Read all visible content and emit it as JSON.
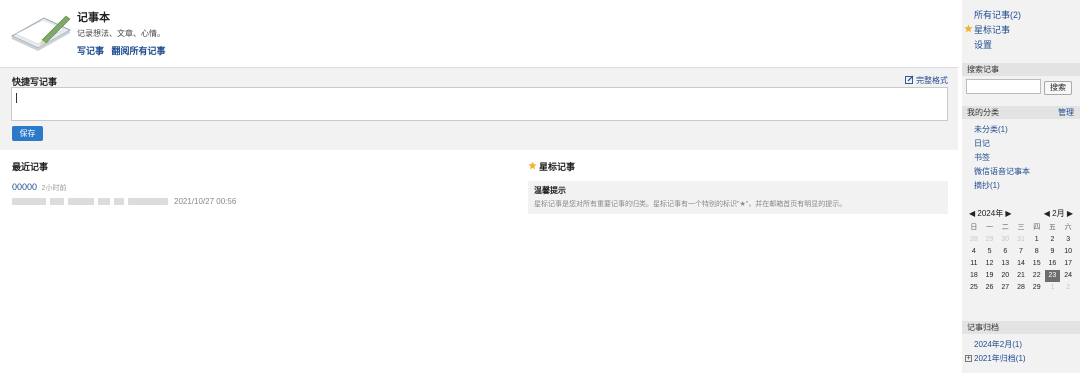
{
  "header": {
    "title": "记事本",
    "subtitle": "记录想法、文章、心情。",
    "links": [
      "写记事",
      "翻阅所有记事"
    ]
  },
  "quick_note": {
    "title": "快捷写记事",
    "full_format": "完整格式",
    "input_value": "",
    "save_label": "保存"
  },
  "recent": {
    "title": "最近记事",
    "items": [
      {
        "title": "00000",
        "ago": "2小时前",
        "date": "2021/10/27 00:56"
      }
    ]
  },
  "starred": {
    "title": "星标记事",
    "tip_title": "温馨提示",
    "tip_text": "星标记事是您对所有重要记事的归类。星标记事有一个特别的标识\"★\"，并在邮箱首页有明显的提示。"
  },
  "sidebar": {
    "nav": [
      "所有记事(2)",
      "星标记事",
      "设置"
    ],
    "search_heading": "搜索记事",
    "search_value": "",
    "search_button": "搜索",
    "categories_heading": "我的分类",
    "manage_label": "管理",
    "categories": [
      "未分类(1)",
      "日记",
      "书签",
      "微信语音记事本",
      "摘抄(1)"
    ],
    "calendar": {
      "year_label": "2024年",
      "month_label": "2月",
      "weekdays": [
        "日",
        "一",
        "二",
        "三",
        "四",
        "五",
        "六"
      ],
      "rows": [
        [
          "28",
          "29",
          "30",
          "31",
          "1",
          "2",
          "3"
        ],
        [
          "4",
          "5",
          "6",
          "7",
          "8",
          "9",
          "10"
        ],
        [
          "11",
          "12",
          "13",
          "14",
          "15",
          "16",
          "17"
        ],
        [
          "18",
          "19",
          "20",
          "21",
          "22",
          "23",
          "24"
        ],
        [
          "25",
          "26",
          "27",
          "28",
          "29",
          "1",
          "2"
        ]
      ],
      "today": "23"
    },
    "archive_heading": "记事归档",
    "archive": [
      "2024年2月(1)",
      "2021年归档(1)"
    ]
  },
  "colors": {
    "link": "#1f4c8f",
    "accent_button": "#2b7ac9",
    "star": "#f0b429",
    "panel": "#f2f2f2"
  }
}
